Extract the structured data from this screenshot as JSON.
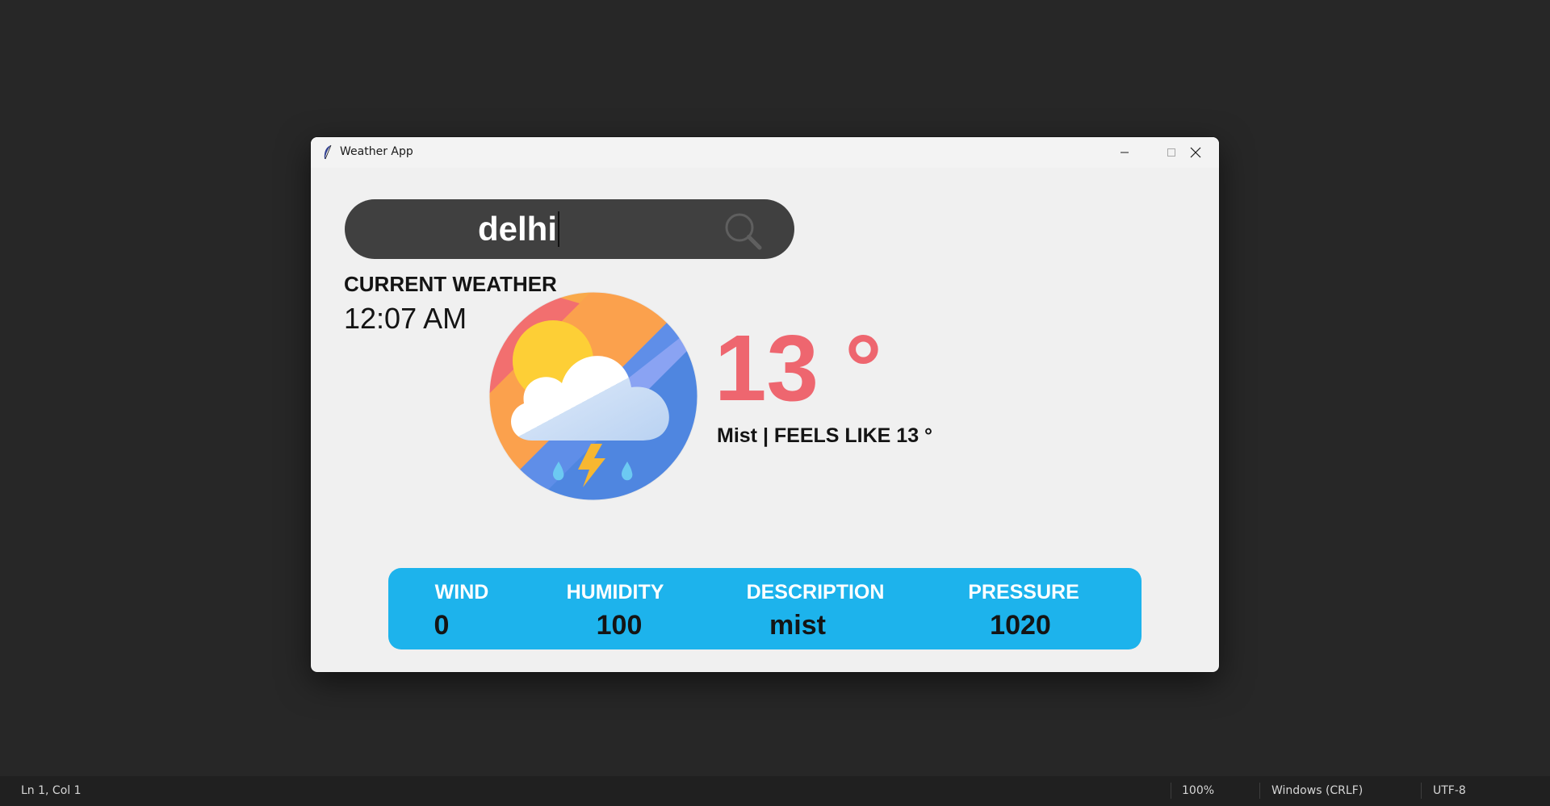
{
  "window": {
    "title": "Weather App",
    "controls": {
      "minimize_icon": "minimize-icon",
      "maximize_icon": "maximize-icon",
      "close_icon": "close-icon"
    }
  },
  "search": {
    "value": "delhi",
    "icon": "search-icon"
  },
  "current": {
    "heading": "CURRENT WEATHER",
    "time": "12:07 AM",
    "icon": "weather-cloud-sun-storm-icon",
    "temperature": "13 °",
    "condition": "Mist | FEELS LIKE 13 °"
  },
  "info": {
    "wind": {
      "label": "WIND",
      "value": "0"
    },
    "humidity": {
      "label": "HUMIDITY",
      "value": "100"
    },
    "description": {
      "label": "DESCRIPTION",
      "value": "mist"
    },
    "pressure": {
      "label": "PRESSURE",
      "value": "1020"
    }
  },
  "statusbar": {
    "position": "Ln 1, Col 1",
    "zoom": "100%",
    "line_ending": "Windows (CRLF)",
    "encoding": "UTF-8"
  },
  "colors": {
    "desktop": "#272727",
    "window_bg": "#f0f0f0",
    "search_bg": "#404040",
    "temperature": "#ee666f",
    "panel": "#1db3ec"
  }
}
